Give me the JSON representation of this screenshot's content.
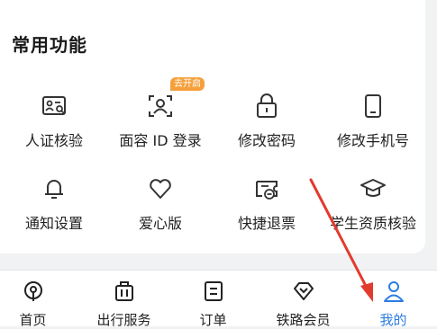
{
  "section": {
    "title": "常用功能",
    "badge": "去开启",
    "items": [
      {
        "label": "人证核验",
        "icon": "id-card-verify-icon"
      },
      {
        "label": "面容 ID 登录",
        "icon": "face-id-icon"
      },
      {
        "label": "修改密码",
        "icon": "lock-icon"
      },
      {
        "label": "修改手机号",
        "icon": "phone-icon"
      },
      {
        "label": "通知设置",
        "icon": "bell-icon"
      },
      {
        "label": "爱心版",
        "icon": "heart-icon"
      },
      {
        "label": "快捷退票",
        "icon": "ticket-refund-icon"
      },
      {
        "label": "学生资质核验",
        "icon": "graduation-cap-icon"
      }
    ]
  },
  "tabbar": {
    "tabs": [
      {
        "label": "首页",
        "icon": "home-train-icon"
      },
      {
        "label": "出行服务",
        "icon": "luggage-icon"
      },
      {
        "label": "订单",
        "icon": "order-list-icon"
      },
      {
        "label": "铁路会员",
        "icon": "diamond-icon"
      },
      {
        "label": "我的",
        "icon": "user-icon",
        "active": true
      }
    ]
  },
  "colors": {
    "accent": "#2a7de1",
    "badge": "#f5a03c",
    "arrow": "#e23b2e",
    "icon_stroke": "#333333"
  }
}
